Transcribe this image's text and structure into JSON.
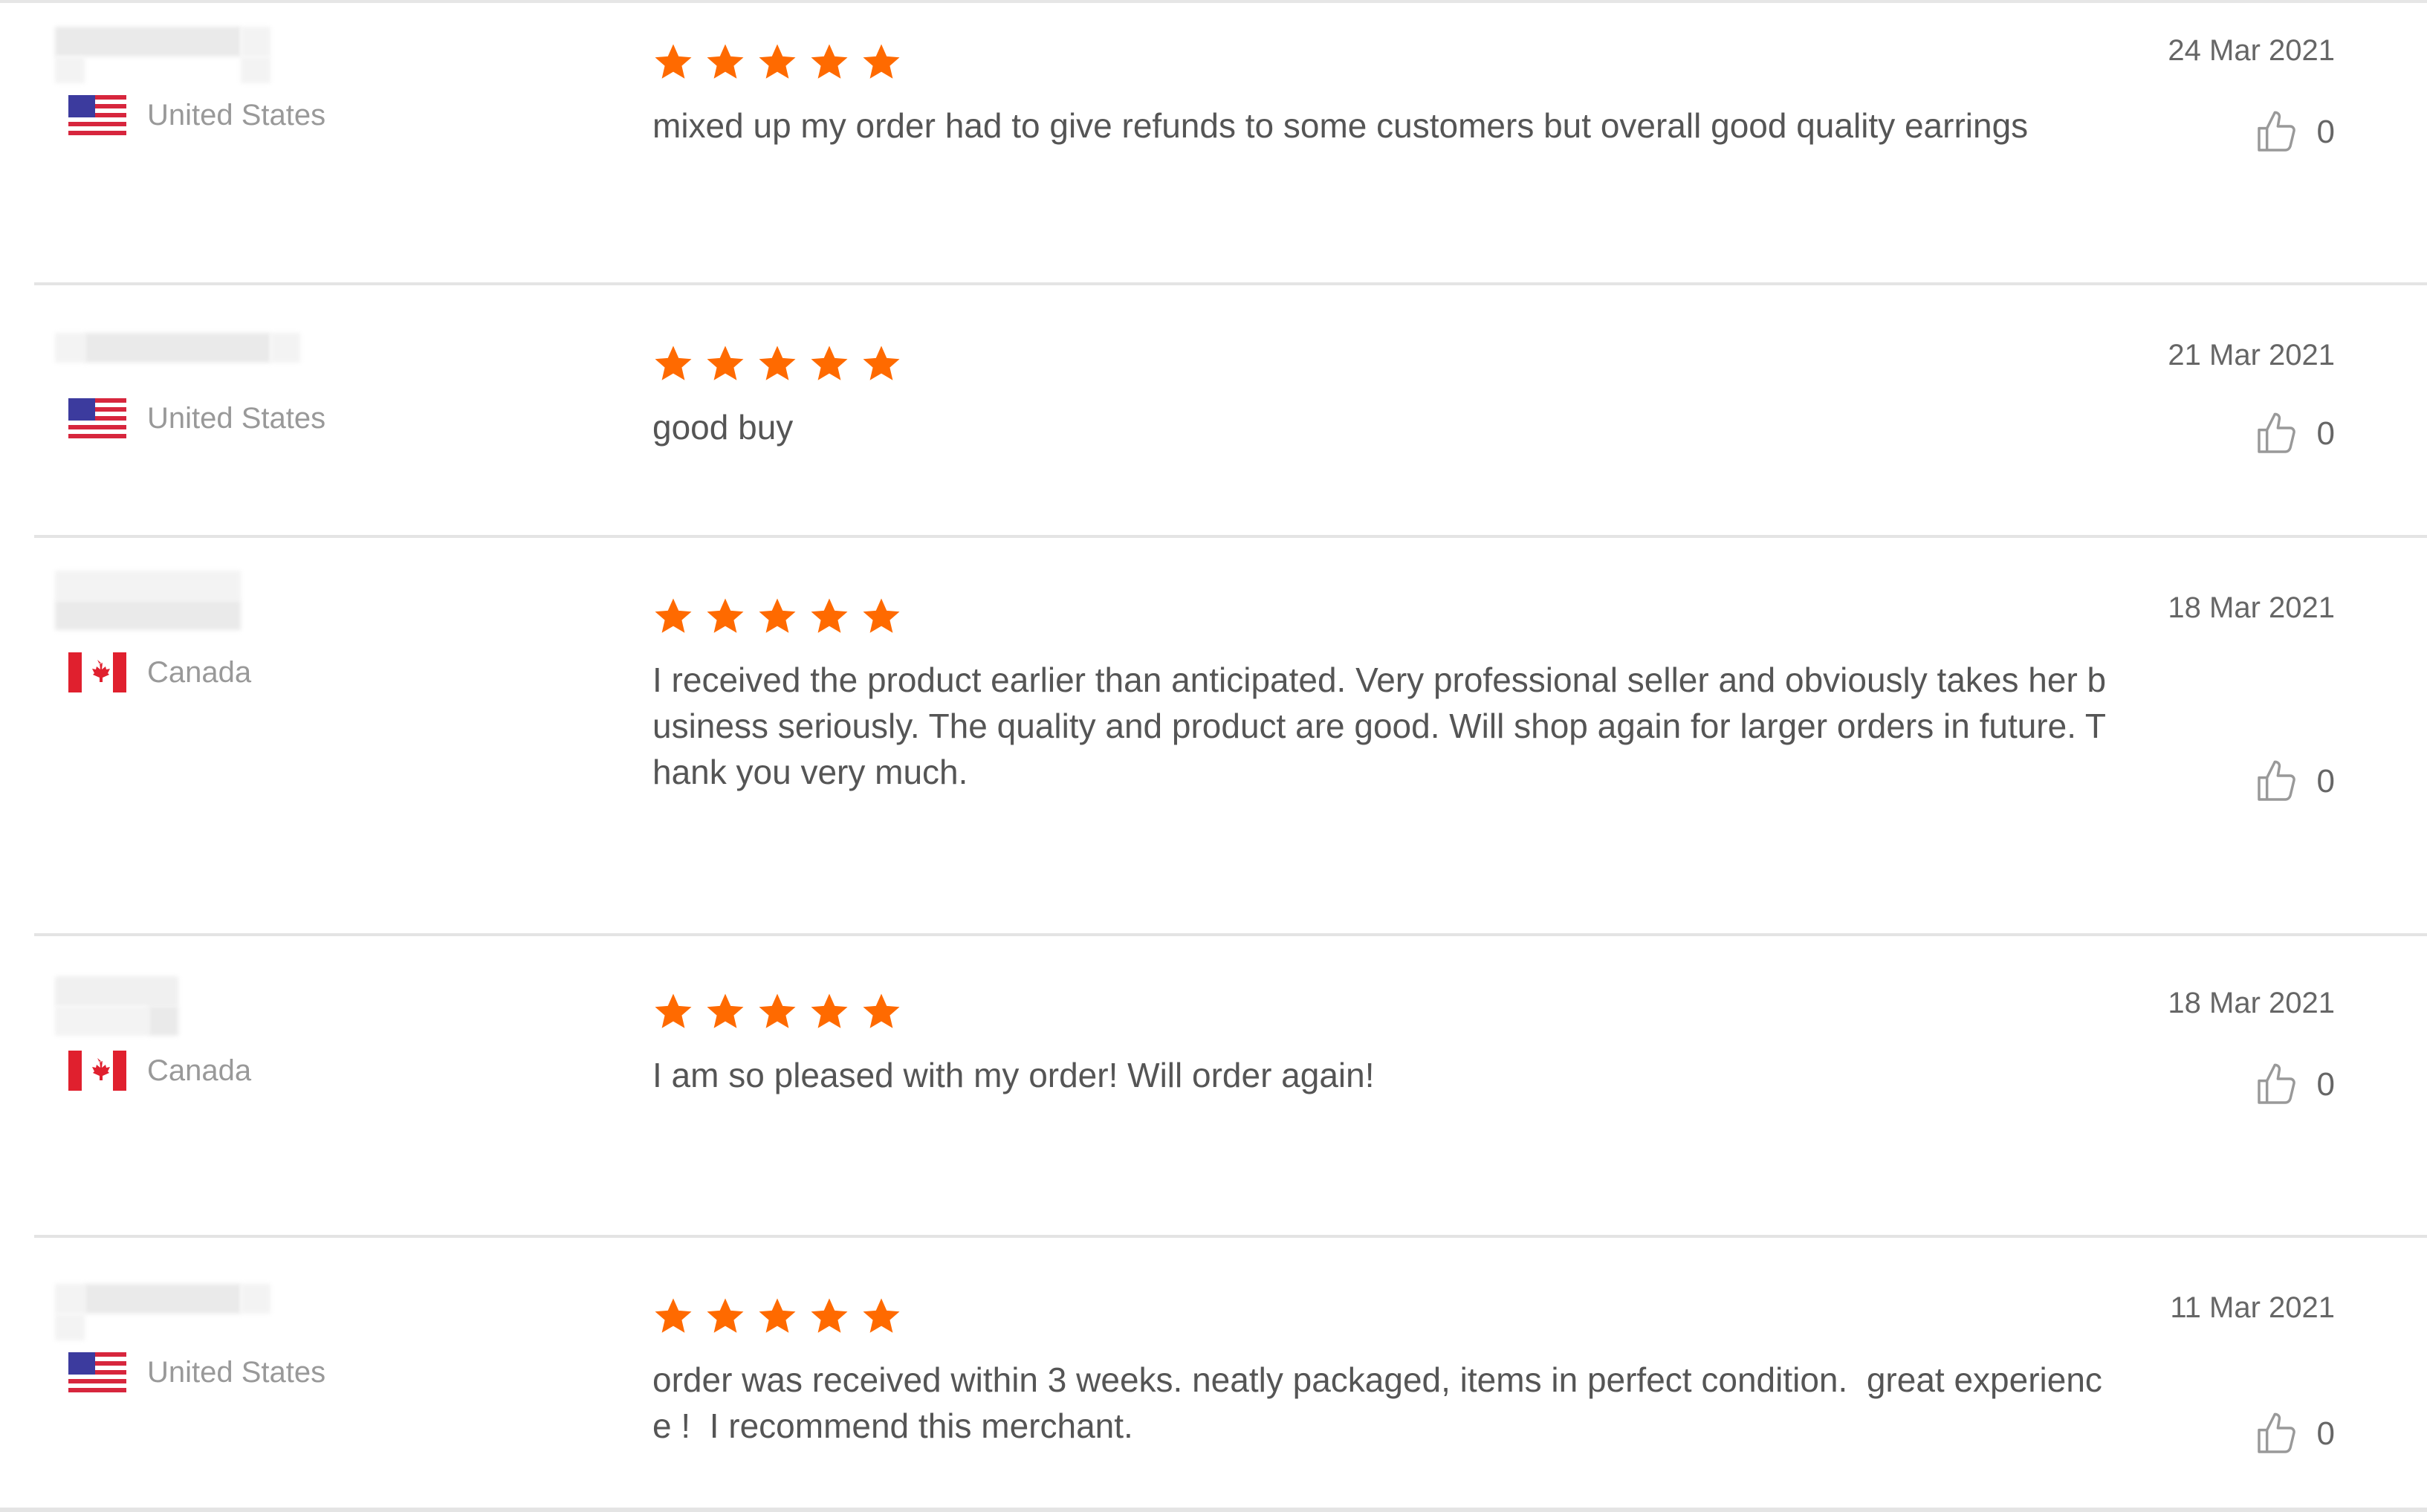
{
  "accent_color": "#ff6a00",
  "star_color": "#ff6a00",
  "reviews": [
    {
      "country": "United States",
      "flag": "us-flag-icon",
      "rating": 5,
      "text": "mixed up my order had to give refunds to some customers but overall good quality earrings",
      "date": "24 Mar 2021",
      "likes": "0"
    },
    {
      "country": "United States",
      "flag": "us-flag-icon",
      "rating": 5,
      "text": "good buy",
      "date": "21 Mar 2021",
      "likes": "0"
    },
    {
      "country": "Canada",
      "flag": "canada-flag-icon",
      "rating": 5,
      "text": "I received the product earlier than anticipated. Very professional seller and obviously takes her business seriously. The quality and product are good. Will shop again for larger orders in future. Thank you very much.",
      "date": "18 Mar 2021",
      "likes": "0"
    },
    {
      "country": "Canada",
      "flag": "canada-flag-icon",
      "rating": 5,
      "text": "I am so pleased with my order! Will order again!",
      "date": "18 Mar 2021",
      "likes": "0"
    },
    {
      "country": "United States",
      "flag": "us-flag-icon",
      "rating": 5,
      "text": "order was received within 3 weeks. neatly packaged, items in perfect condition.  great experience !  I recommend this merchant.",
      "date": "11 Mar 2021",
      "likes": "0"
    }
  ]
}
